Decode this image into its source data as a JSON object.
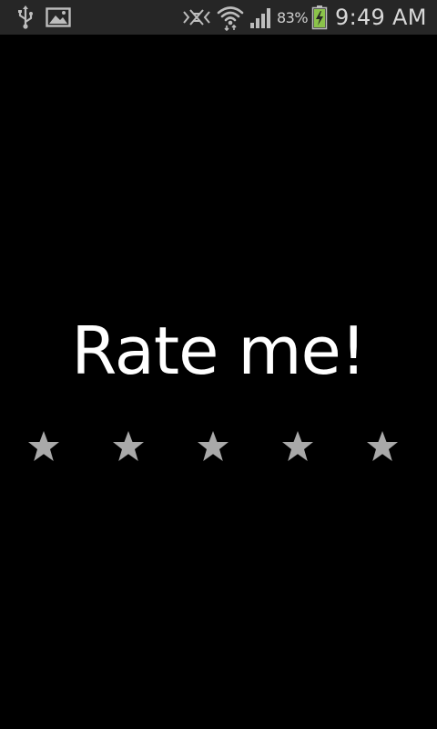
{
  "status_bar": {
    "battery_percent": "83%",
    "time": "9:49 AM",
    "icons": [
      "usb-icon",
      "image-notification-icon",
      "no-signal-icon",
      "wifi-icon",
      "cellular-signal-icon",
      "battery-charging-icon"
    ]
  },
  "main": {
    "title": "Rate me!"
  },
  "rating": {
    "max_stars": 5,
    "value": 0,
    "star_color": "#a9a9a9",
    "star_filled_color": "#ffffff"
  },
  "colors": {
    "background": "#000000",
    "status_bar_bg": "#262626",
    "status_icon": "#bdbdbd",
    "battery_fill": "#8bc34a",
    "title_text": "#ffffff"
  }
}
